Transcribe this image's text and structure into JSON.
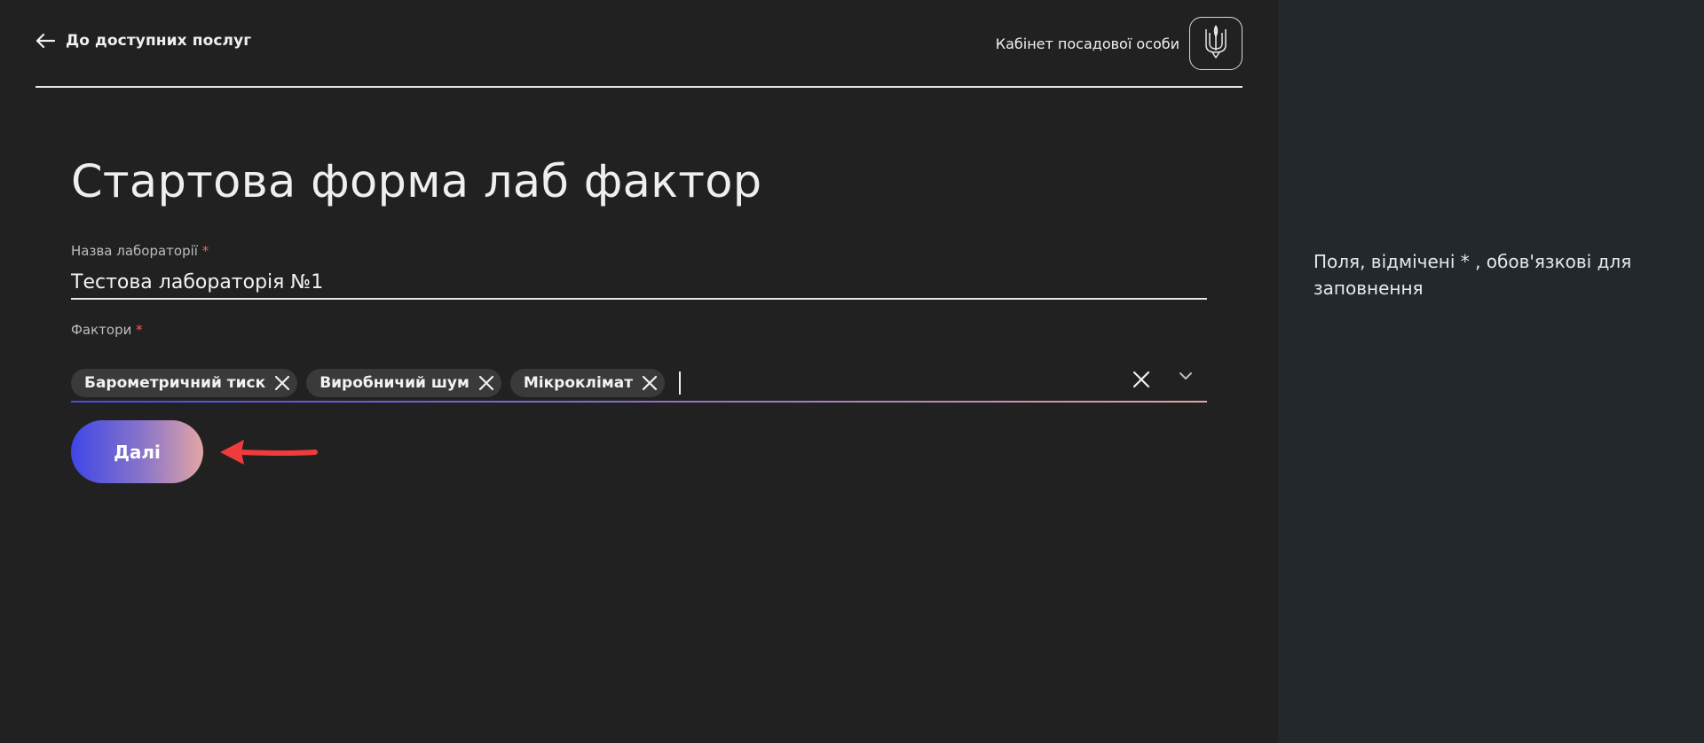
{
  "header": {
    "back_label": "До доступних послуг",
    "cabinet_label": "Кабінет посадової особи"
  },
  "form": {
    "title": "Стартова форма лаб фактор",
    "lab_name": {
      "label": "Назва лабораторії",
      "required_mark": "*",
      "value": "Тестова лабораторія №1"
    },
    "factors": {
      "label": "Фактори",
      "required_mark": "*",
      "selected": [
        "Барометричний тиск",
        "Виробничий шум",
        "Мікроклімат"
      ]
    },
    "next_label": "Далі"
  },
  "aside": {
    "note": "Поля, відмічені * , обов'язкові для заповнення"
  },
  "colors": {
    "background": "#212121",
    "aside_background": "#23282d",
    "gradient_start": "#3f46e6",
    "gradient_end": "#e3a5a5",
    "required": "#ff5a5a",
    "annotation_arrow": "#ef3b3b"
  },
  "icons": {
    "back": "arrow-left-icon",
    "emblem": "trident-icon",
    "chip_remove": "close-icon",
    "clear": "close-icon",
    "dropdown": "chevron-down-icon"
  }
}
